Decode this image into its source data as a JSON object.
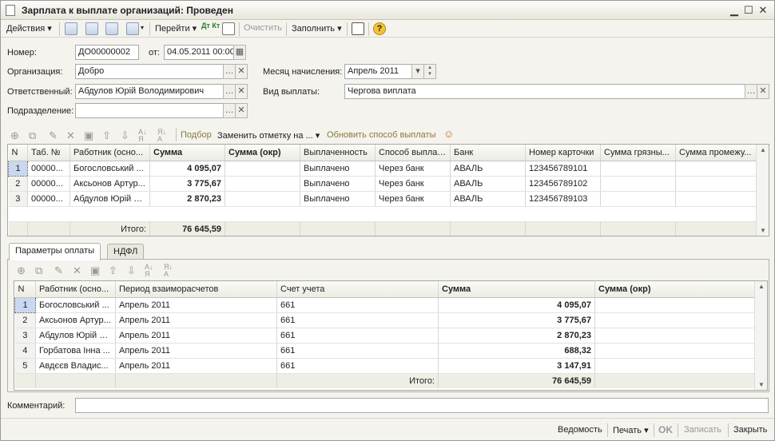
{
  "window": {
    "title": "Зарплата к выплате организаций: Проведен",
    "min": "▁",
    "max": "☐",
    "close": "✕"
  },
  "toolbar": {
    "actions": "Действия",
    "goto": "Перейти",
    "clear": "Очистить",
    "fill": "Заполнить",
    "dtkt": "Дт Кт",
    "help": "?"
  },
  "form": {
    "number_label": "Номер:",
    "number_value": "ДО00000002",
    "date_label": "от:",
    "date_value": "04.05.2011 00:00",
    "org_label": "Организация:",
    "org_value": "Добро",
    "month_label": "Месяц начисления:",
    "month_value": "Апрель 2011",
    "resp_label": "Ответственный:",
    "resp_value": "Абдулов Юрій Володимирович",
    "paytype_label": "Вид выплаты:",
    "paytype_value": "Чергова виплата",
    "dept_label": "Подразделение:",
    "dept_value": ""
  },
  "grid_toolbar": {
    "pick": "Подбор",
    "replace": "Заменить отметку на ...",
    "update": "Обновить способ выплаты"
  },
  "grid1": {
    "headers": [
      "N",
      "Таб. №",
      "Работник (осно...",
      "Сумма",
      "Сумма (окр)",
      "Выплаченность",
      "Способ выплаты",
      "Банк",
      "Номер карточки",
      "Сумма грязны...",
      "Сумма промежу..."
    ],
    "rows": [
      [
        "1",
        "00000...",
        "Богословський ...",
        "4 095,07",
        "",
        "Выплачено",
        "Через банк",
        "АВАЛЬ",
        "123456789101",
        "",
        ""
      ],
      [
        "2",
        "00000...",
        "Аксьонов Артур...",
        "3 775,67",
        "",
        "Выплачено",
        "Через банк",
        "АВАЛЬ",
        "123456789102",
        "",
        ""
      ],
      [
        "3",
        "00000...",
        "Абдулов Юрій В...",
        "2 870,23",
        "",
        "Выплачено",
        "Через банк",
        "АВАЛЬ",
        "123456789103",
        "",
        ""
      ]
    ],
    "total_label": "Итого:",
    "total_value": "76 645,59"
  },
  "tabs": [
    "Параметры оплаты",
    "НДФЛ"
  ],
  "grid2": {
    "headers": [
      "N",
      "Работник (осно...",
      "Период взаиморасчетов",
      "Счет учета",
      "Сумма",
      "Сумма (окр)"
    ],
    "rows": [
      [
        "1",
        "Богословський ...",
        "Апрель 2011",
        "661",
        "4 095,07",
        ""
      ],
      [
        "2",
        "Аксьонов Артур...",
        "Апрель 2011",
        "661",
        "3 775,67",
        ""
      ],
      [
        "3",
        "Абдулов Юрій В...",
        "Апрель 2011",
        "661",
        "2 870,23",
        ""
      ],
      [
        "4",
        "Горбатова Інна ...",
        "Апрель 2011",
        "661",
        "688,32",
        ""
      ],
      [
        "5",
        "Авдєєв Владис...",
        "Апрель 2011",
        "661",
        "3 147,91",
        ""
      ]
    ],
    "total_label": "Итого:",
    "total_value": "76 645,59"
  },
  "comment_label": "Комментарий:",
  "comment_value": "",
  "bottom": {
    "statement": "Ведомость",
    "print": "Печать",
    "ok": "OK",
    "save": "Записать",
    "close": "Закрыть"
  }
}
